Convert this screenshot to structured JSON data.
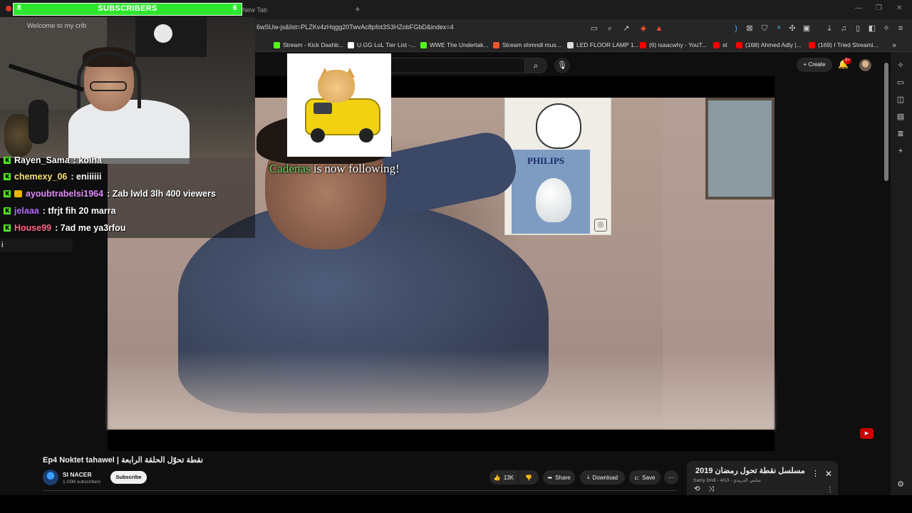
{
  "browser": {
    "new_tab_label": "New Tab",
    "url": "6wSUw-js&list=PLZKv4zHqgg20TwvAc8pfot3S3HZobFGbD&index=4",
    "bookmarks": [
      {
        "label": "Stream - Kick Dashb...",
        "color": "#53fc18"
      },
      {
        "label": "U.GG LoL Tier List -...",
        "color": "#ffffff"
      },
      {
        "label": "WWE The Undertak...",
        "color": "#53fc18"
      },
      {
        "label": "Stream shmndl mus...",
        "color": "#e8572c"
      },
      {
        "label": "LED FLOOR LAMP 1...",
        "color": "#dddddd"
      },
      {
        "label": "(6) isaacwhy - YouT...",
        "color": "#ff0000"
      },
      {
        "label": "st",
        "color": "#ff0000"
      },
      {
        "label": "(168) Ahmed Adly |...",
        "color": "#ff0000"
      },
      {
        "label": "(169) I Tried Streami...",
        "color": "#ff0000"
      }
    ]
  },
  "youtube_header": {
    "create_label": "Create",
    "notification_badge": "9+"
  },
  "overlay": {
    "subscribers": {
      "label": "SUBSCRIBERS",
      "current": "8",
      "goal": "6"
    },
    "webcam_sign": "Welcome to my crib",
    "alert": {
      "name": "Cadenas",
      "message": " is now following!"
    },
    "chat": [
      {
        "user": "Rayen_Sama",
        "user_color": "#ffffff",
        "text": ": kolha",
        "badges": [
          "kick"
        ]
      },
      {
        "user": "chemexy_06",
        "user_color": "#f6e27a",
        "text": ": eniiiiii",
        "badges": [
          "kick"
        ]
      },
      {
        "user": "ayoubtrabelsi1964",
        "user_color": "#e58cff",
        "text": ": Zab lwld 3lh 400 viewers",
        "badges": [
          "kick",
          "crown"
        ]
      },
      {
        "user": "jelaaa",
        "user_color": "#b26cff",
        "text": ": tfrjt fih 20 marra",
        "badges": [
          "kick"
        ]
      },
      {
        "user": "House99",
        "user_color": "#ff6b8a",
        "text": ": 7ad me ya3rfou",
        "badges": [
          "kick"
        ]
      }
    ],
    "chat_input": "i"
  },
  "video": {
    "title": "Ep4 Noktet tahawel | نقطة تحوّل الحلقة الرابعة",
    "poster_brand": "PHILIPS",
    "channel": {
      "name": "SI NACER",
      "subscribers": "1,03M subscribers",
      "subscribe_label": "Subscribe"
    },
    "actions": {
      "likes": "13K",
      "share": "Share",
      "download": "Download",
      "save": "Save"
    }
  },
  "playlist": {
    "title": "مسلسل نقطة تحول رمضان 2019",
    "meta": "Samy Dridi - سامي الدريدي - 4/13"
  }
}
